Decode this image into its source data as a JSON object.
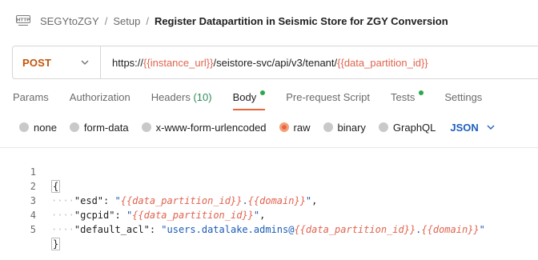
{
  "breadcrumb": {
    "items": [
      "SEGYtoZGY",
      "Setup"
    ],
    "separator": "/",
    "current": "Register Datapartition in Seismic Store for ZGY Conversion",
    "icon": "http-icon"
  },
  "request": {
    "method": "POST",
    "url_prefix": "https://",
    "url_var1": "{{instance_url}}",
    "url_mid": "/seistore-svc/api/v3/tenant/",
    "url_var2": "{{data_partition_id}}"
  },
  "tabs": {
    "params": "Params",
    "authorization": "Authorization",
    "headers": "Headers",
    "headers_count": "(10)",
    "body": "Body",
    "prerequest": "Pre-request Script",
    "tests": "Tests",
    "settings": "Settings"
  },
  "body_types": {
    "none": "none",
    "form_data": "form-data",
    "urlencoded": "x-www-form-urlencoded",
    "raw": "raw",
    "binary": "binary",
    "graphql": "GraphQL",
    "format": "JSON"
  },
  "editor": {
    "line_numbers": [
      "1",
      "2",
      "3",
      "4",
      "5"
    ],
    "open_brace": "{",
    "close_brace": "}",
    "indent": "····",
    "line2": {
      "key": "\"esd\"",
      "colon": ": ",
      "q1": "\"",
      "var1": "{{data_partition_id}}",
      "dot": ".",
      "var2": "{{domain}}",
      "q2": "\"",
      "comma": ","
    },
    "line3": {
      "key": "\"gcpid\"",
      "colon": ": ",
      "q1": "\"",
      "var1": "{{data_partition_id}}",
      "q2": "\"",
      "comma": ","
    },
    "line4": {
      "key": "\"default_acl\"",
      "colon": ": ",
      "q1": "\"users.datalake.admins@",
      "var1": "{{data_partition_id}}",
      "dot": ".",
      "var2": "{{domain}}",
      "q2": "\""
    }
  },
  "colors": {
    "method": "#c2540a",
    "variable": "#e0644f",
    "active_tab_underline": "#e8643b",
    "status_dot": "#2ba84a",
    "json_string": "#1a5bb5",
    "format_select": "#1f5fbf"
  }
}
